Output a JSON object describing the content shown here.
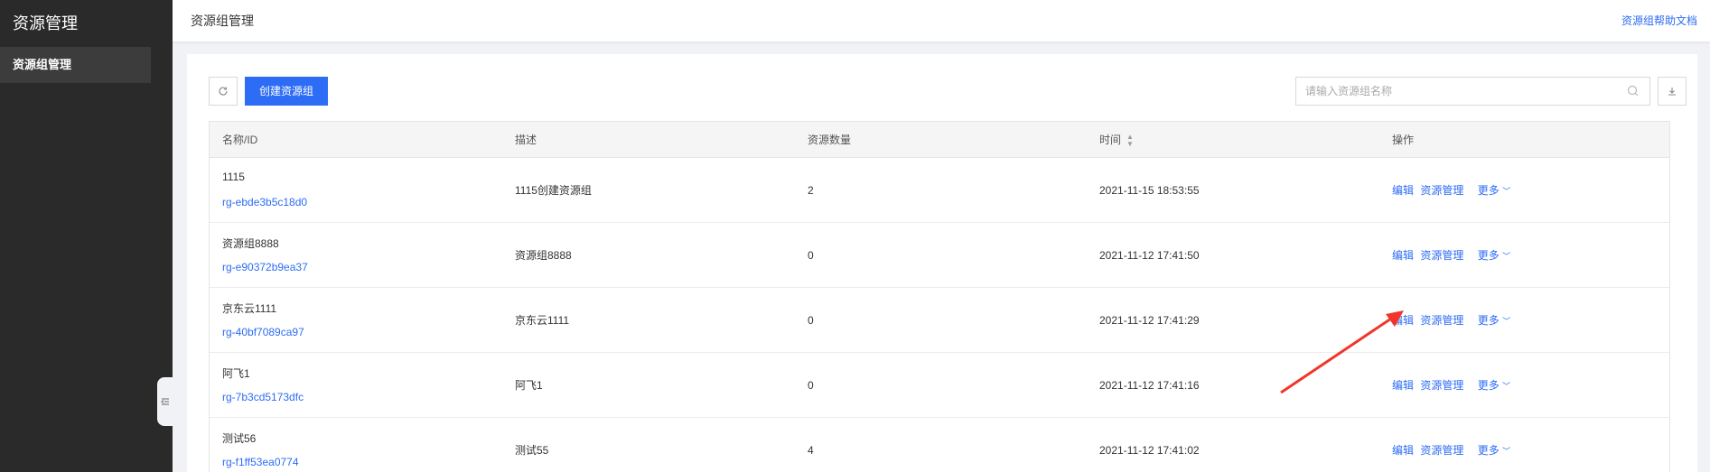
{
  "sidebar": {
    "title": "资源管理",
    "items": [
      {
        "label": "资源组管理"
      }
    ],
    "collapse_icon": "collapse-left-icon"
  },
  "header": {
    "title": "资源组管理",
    "help_link": "资源组帮助文档"
  },
  "toolbar": {
    "refresh_icon": "refresh-icon",
    "create_label": "创建资源组",
    "search_placeholder": "请输入资源组名称",
    "search_icon": "search-icon",
    "download_icon": "download-icon"
  },
  "table": {
    "headers": {
      "name": "名称/ID",
      "desc": "描述",
      "count": "资源数量",
      "time": "时间",
      "op": "操作"
    },
    "rows": [
      {
        "name": "1115",
        "id": "rg-ebde3b5c18d0",
        "desc": "1115创建资源组",
        "count": "2",
        "time": "2021-11-15 18:53:55"
      },
      {
        "name": "资源组8888",
        "id": "rg-e90372b9ea37",
        "desc": "资源组8888",
        "count": "0",
        "time": "2021-11-12 17:41:50"
      },
      {
        "name": "京东云1111",
        "id": "rg-40bf7089ca97",
        "desc": "京东云1111",
        "count": "0",
        "time": "2021-11-12 17:41:29"
      },
      {
        "name": "阿飞1",
        "id": "rg-7b3cd5173dfc",
        "desc": "阿飞1",
        "count": "0",
        "time": "2021-11-12 17:41:16"
      },
      {
        "name": "测试56",
        "id": "rg-f1ff53ea0774",
        "desc": "测试55",
        "count": "4",
        "time": "2021-11-12 17:41:02"
      }
    ],
    "actions": {
      "edit": "编辑",
      "manage": "资源管理",
      "more": "更多"
    }
  },
  "colors": {
    "accent": "#2d6cf5",
    "sidebar_bg": "#2a2a2a",
    "annotation_arrow": "#f2352b"
  }
}
